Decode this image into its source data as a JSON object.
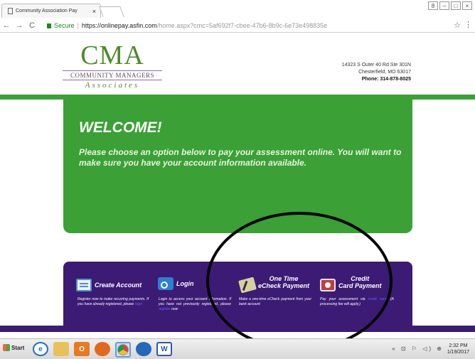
{
  "browser": {
    "tab_title": "Community Association Pay",
    "tab_close": "×",
    "secure_label": "Secure",
    "url_base": "https://onlinepay.asfin.com",
    "url_rest": "/home.aspx?cmc=5af692f7-cbee-47b6-8b9c-6e73e498835e",
    "nav_back": "←",
    "nav_forward": "→",
    "nav_reload": "C",
    "star": "☆",
    "menu": "⋮",
    "window_controls": [
      "8",
      "–",
      "□",
      "×"
    ]
  },
  "logo": {
    "letters": "CMA",
    "line1": "COMMUNITY MANAGERS",
    "line2": "Associates"
  },
  "address": {
    "street": "14323 S Outer 40 Rd Ste 301N",
    "city": "Chesterfield, MO 63017",
    "phone": "Phone: 314-878-8025"
  },
  "welcome": {
    "title": "WELCOME!",
    "message": "Please choose an option below to pay your assessment online. You will want to make sure you have your account information available."
  },
  "options": {
    "create": {
      "title": "Create Account",
      "desc_a": "Register now to make recurring payments. If you have already registered, please ",
      "desc_link": "login"
    },
    "login": {
      "title": "Login",
      "desc_a": "Login to access your account information. If you have not previously registered, please ",
      "desc_link": "register",
      "desc_b": " now"
    },
    "echeck": {
      "title_1": "One Time",
      "title_2": "eCheck Payment",
      "desc_a": "Make a one-time eCheck payment from your bank account"
    },
    "card": {
      "title_1": "Credit",
      "title_2": "Card Payment",
      "desc_a": "Pay your assessment via ",
      "desc_link": "credit card",
      "desc_b": ". (A processing fee will apply.)"
    }
  },
  "taskbar": {
    "start": "Start",
    "tray": "« ⊡ ⚐ ◁) ⊕",
    "time": "2:32 PM",
    "date": "1/19/2017"
  },
  "colors": {
    "green": "#3ba036",
    "purple": "#3b1b74"
  }
}
